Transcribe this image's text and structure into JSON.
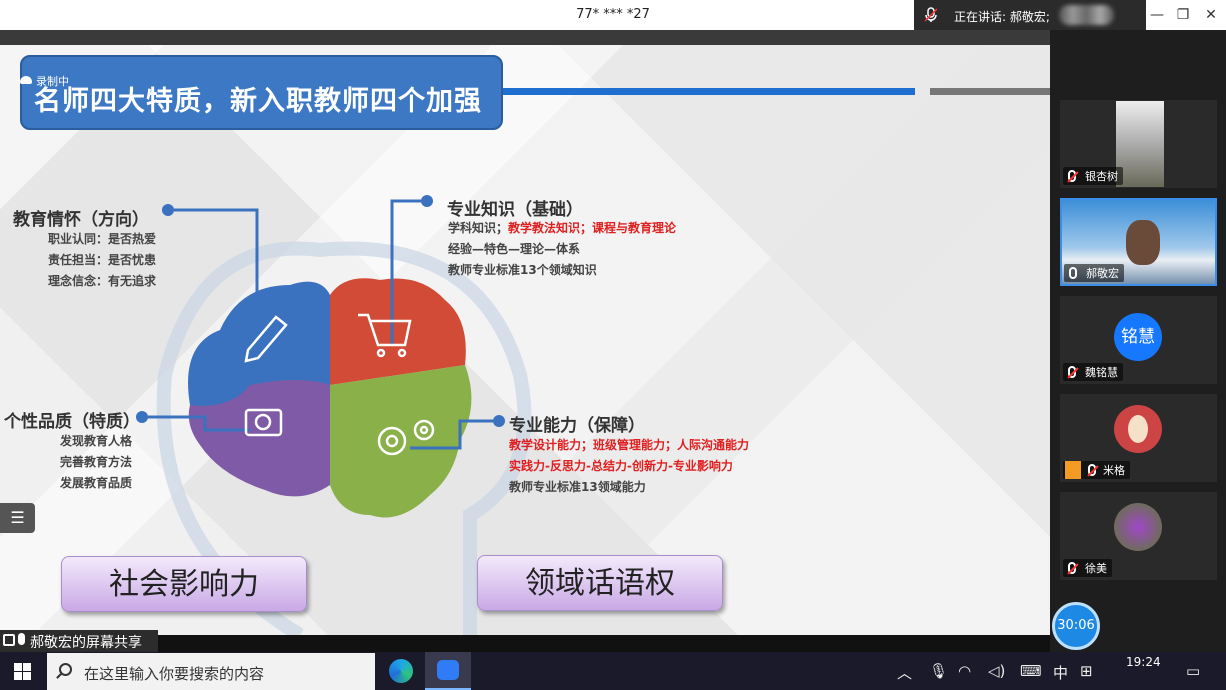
{
  "window": {
    "title": "77* *** *27",
    "speaking_label": "正在讲话: 郝敬宏;"
  },
  "slide": {
    "recording": "录制中",
    "title": "名师四大特质，新入职教师四个加强",
    "sec1": {
      "heading": "教育情怀（方向）",
      "lines": [
        "职业认同：是否热爱",
        "责任担当：是否忧患",
        "理念信念：有无追求"
      ]
    },
    "sec2": {
      "heading": "专业知识（基础）",
      "line1_black": "学科知识；",
      "line1_red": "教学教法知识；课程与教育理论",
      "line2": "经验—特色—理论—体系",
      "line3": "教师专业标准13个领域知识"
    },
    "sec3": {
      "heading": "个性品质（特质）",
      "lines": [
        "发现教育人格",
        "完善教育方法",
        "发展教育品质"
      ]
    },
    "sec4": {
      "heading": "专业能力（保障）",
      "line1": "教学设计能力；班级管理能力；人际沟通能力",
      "line2": "实践力-反思力-总结力-创新力-专业影响力",
      "line3": "教师专业标准13领域能力"
    },
    "btn_left": "社会影响力",
    "btn_right": "领域话语权"
  },
  "share_label": "郝敬宏的屏幕共享",
  "participants": [
    {
      "name": "银杏树"
    },
    {
      "name": "郝敬宏"
    },
    {
      "name": "魏铭慧",
      "avatar": "铭慧"
    },
    {
      "name": "米格"
    },
    {
      "name": "徐美"
    }
  ],
  "timer": "30:06",
  "taskbar": {
    "search_placeholder": "在这里输入你要搜索的内容",
    "ime": "中",
    "time": "19:24"
  },
  "colors": {
    "title_blue": "#3d78c4",
    "accent_red": "#e02020",
    "brain_blue": "#3b72bf",
    "brain_red": "#d14b36",
    "brain_purple": "#7f5aa6",
    "brain_green": "#8ab04a"
  }
}
